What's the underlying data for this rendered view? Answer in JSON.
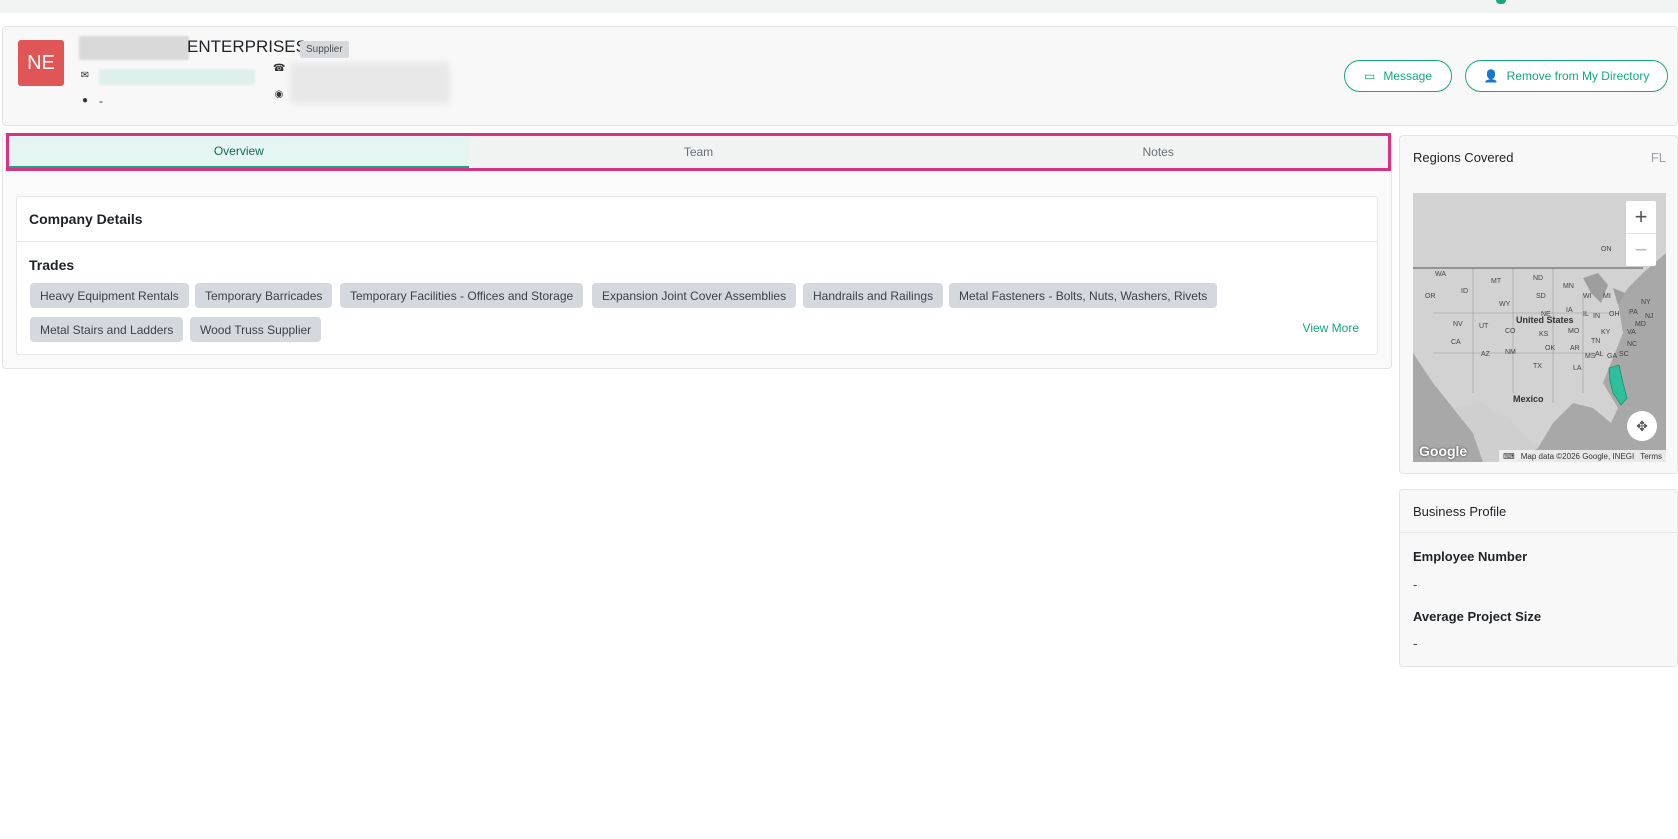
{
  "company": {
    "initials": "NE",
    "name_visible": "ENTERPRISES",
    "type_badge": "Supplier",
    "website": "-",
    "icons": {
      "email": "email-icon",
      "phone": "phone-icon",
      "website": "globe-icon",
      "location": "location-pin-icon"
    }
  },
  "actions": {
    "message_label": "Message",
    "remove_label": "Remove from My Directory"
  },
  "tabs": [
    {
      "label": "Overview",
      "active": true
    },
    {
      "label": "Team",
      "active": false
    },
    {
      "label": "Notes",
      "active": false
    }
  ],
  "company_details": {
    "title": "Company Details",
    "trades_label": "Trades",
    "trades": [
      "Heavy Equipment Rentals",
      "Temporary Barricades",
      "Temporary Facilities - Offices and Storage",
      "Expansion Joint Cover Assemblies",
      "Handrails and Railings",
      "Metal Fasteners - Bolts, Nuts, Washers, Rivets",
      "Metal Stairs and Ladders",
      "Wood Truss Supplier"
    ],
    "view_more": "View More"
  },
  "regions": {
    "title": "Regions Covered",
    "code": "FL",
    "map": {
      "labels": {
        "us": "United States",
        "mexico": "Mexico",
        "on": "ON",
        "mt": "MT",
        "nd": "ND",
        "mn": "MN",
        "wy": "WY",
        "sd": "SD",
        "ne": "NE",
        "ia": "IA",
        "nv": "NV",
        "ut": "UT",
        "co": "CO",
        "ks": "KS",
        "mo": "MO",
        "ca": "CA",
        "az": "AZ",
        "nm": "NM",
        "ok": "OK",
        "ar": "AR",
        "tx": "TX",
        "la": "LA",
        "ms": "MS",
        "al": "AL",
        "ga": "GA",
        "tn": "TN",
        "ky": "KY",
        "il": "IL",
        "in": "IN",
        "oh": "OH",
        "mi": "MI",
        "wi": "WI",
        "or": "OR",
        "id": "ID",
        "wa": "WA",
        "ny": "NY",
        "pa": "PA",
        "va": "VA",
        "nc": "NC",
        "sc": "SC",
        "md": "MD",
        "nj": "NJ"
      },
      "google": "Google",
      "attribution": "Map data ©2026 Google, INEGI",
      "terms": "Terms",
      "highlight_color": "#2fbf9a"
    }
  },
  "business_profile": {
    "title": "Business Profile",
    "employee_label": "Employee Number",
    "employee_value": "-",
    "project_label": "Average Project Size",
    "project_value": "-"
  }
}
